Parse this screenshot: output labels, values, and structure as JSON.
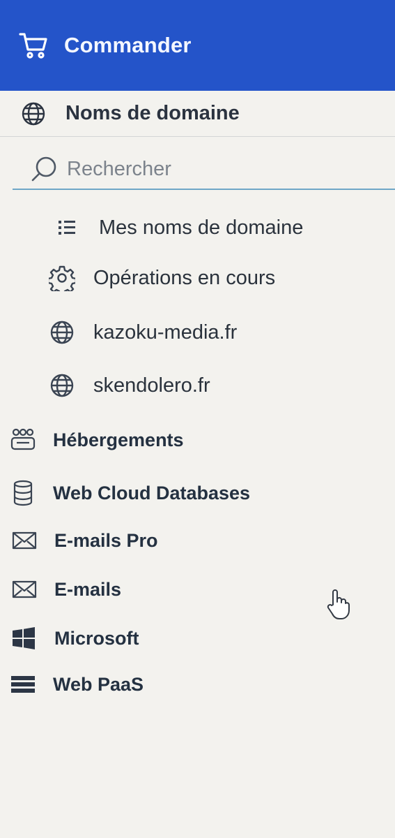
{
  "commander": {
    "label": "Commander",
    "icon": "cart-icon"
  },
  "domains": {
    "header": "Noms de domaine",
    "icon": "globe-icon",
    "search_placeholder": "Rechercher",
    "items": [
      {
        "label": "Mes noms de domaine",
        "icon": "list-icon"
      },
      {
        "label": "Opérations en cours",
        "icon": "gear-icon"
      },
      {
        "label": "kazoku-media.fr",
        "icon": "globe-icon"
      },
      {
        "label": "skendolero.fr",
        "icon": "globe-icon"
      }
    ]
  },
  "menu": [
    {
      "label": "Hébergements",
      "icon": "hosting-icon"
    },
    {
      "label": "Web Cloud Databases",
      "icon": "database-icon"
    },
    {
      "label": "E-mails Pro",
      "icon": "envelope-icon"
    },
    {
      "label": "E-mails",
      "icon": "envelope-icon"
    },
    {
      "label": "Microsoft",
      "icon": "windows-icon"
    },
    {
      "label": "Web PaaS",
      "icon": "stack-icon"
    }
  ],
  "colors": {
    "accent": "#2454c9",
    "search_underline": "#6fa7c7",
    "background": "#f3f2ee"
  }
}
